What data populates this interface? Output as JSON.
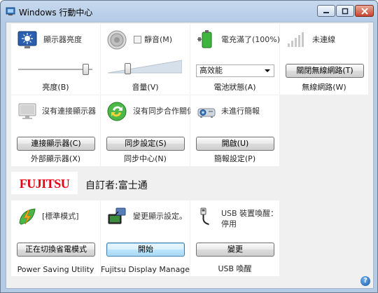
{
  "window": {
    "title": "Windows 行動中心"
  },
  "tiles": {
    "brightness": {
      "text": "顯示器亮度",
      "label": "亮度(B)",
      "slider_value": 0.95
    },
    "volume": {
      "mute_label": "靜音(M)",
      "label": "音量(V)",
      "slider_value": 0.25
    },
    "battery": {
      "text": "電充滿了(100%)",
      "select_value": "高效能",
      "label": "電池狀態(A)"
    },
    "wireless": {
      "text": "未連線",
      "button": "關閉無線網路(T)",
      "label": "無線網路(W)"
    },
    "display": {
      "text": "沒有連接顯示器",
      "button": "連接顯示器(C)",
      "label": "外部顯示器(X)"
    },
    "sync": {
      "text": "沒有同步合作關係",
      "button": "同步設定(S)",
      "label": "同步中心(N)"
    },
    "presentation": {
      "text": "未進行簡報",
      "button": "開啟(U)",
      "label": "簡報設定(P)"
    }
  },
  "oem": {
    "logo": "FUJITSU",
    "customized_by": "自訂者:富士通"
  },
  "oem_tiles": {
    "power_saving": {
      "text": "[標準模式]",
      "button": "正在切換省電模式",
      "label": "Power Saving Utility"
    },
    "display_manager": {
      "text": "變更顯示設定。",
      "button": "開始",
      "label": "Fujitsu Display Manager"
    },
    "usb_wakeup": {
      "text_line1": "USB 裝置喚醒：",
      "text_line2": "停用",
      "button": "變更",
      "label": "USB 喚醒"
    }
  },
  "help": {
    "glyph": "?"
  },
  "colors": {
    "accent": "#3c7fb1",
    "fujitsu_red": "#e60012"
  }
}
